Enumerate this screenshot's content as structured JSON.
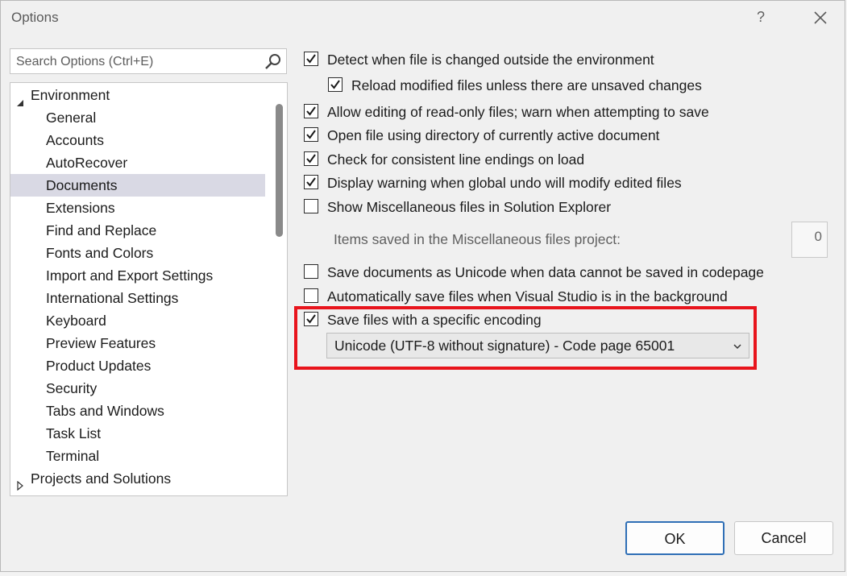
{
  "window": {
    "title": "Options",
    "help_label": "?"
  },
  "search": {
    "placeholder": "Search Options (Ctrl+E)"
  },
  "tree": {
    "root": {
      "label": "Environment",
      "expanded": true
    },
    "items": [
      {
        "label": "General"
      },
      {
        "label": "Accounts"
      },
      {
        "label": "AutoRecover"
      },
      {
        "label": "Documents",
        "selected": true
      },
      {
        "label": "Extensions"
      },
      {
        "label": "Find and Replace"
      },
      {
        "label": "Fonts and Colors"
      },
      {
        "label": "Import and Export Settings"
      },
      {
        "label": "International Settings"
      },
      {
        "label": "Keyboard"
      },
      {
        "label": "Preview Features"
      },
      {
        "label": "Product Updates"
      },
      {
        "label": "Security"
      },
      {
        "label": "Tabs and Windows"
      },
      {
        "label": "Task List"
      },
      {
        "label": "Terminal"
      }
    ],
    "next_root": {
      "label": "Projects and Solutions",
      "expanded": false
    }
  },
  "options": {
    "detect_changes": {
      "label": "Detect when file is changed outside the environment",
      "checked": true
    },
    "reload_modified": {
      "label": "Reload modified files unless there are unsaved changes",
      "checked": true
    },
    "allow_editing_readonly": {
      "label": "Allow editing of read-only files; warn when attempting to save",
      "checked": true
    },
    "open_using_directory": {
      "label": "Open file using directory of currently active document",
      "checked": true
    },
    "check_line_endings": {
      "label": "Check for consistent line endings on load",
      "checked": true
    },
    "global_undo_warning": {
      "label": "Display warning when global undo will modify edited files",
      "checked": true
    },
    "show_misc_files": {
      "label": "Show Miscellaneous files in Solution Explorer",
      "checked": false
    },
    "items_saved_label": "Items saved in the Miscellaneous files project:",
    "items_saved_value": "0",
    "save_as_unicode": {
      "label": "Save documents as Unicode when data cannot be saved in codepage",
      "checked": false
    },
    "auto_save_background": {
      "label": "Automatically save files when Visual Studio is in the background",
      "checked": false
    },
    "save_specific_encoding": {
      "label": "Save files with a specific encoding",
      "checked": true
    },
    "encoding_value": "Unicode (UTF-8 without signature) - Code page 65001"
  },
  "buttons": {
    "ok": "OK",
    "cancel": "Cancel"
  },
  "colors": {
    "highlight": "#e8141c",
    "selected_row": "#d9d9e4",
    "ok_border": "#2f6fb6"
  }
}
